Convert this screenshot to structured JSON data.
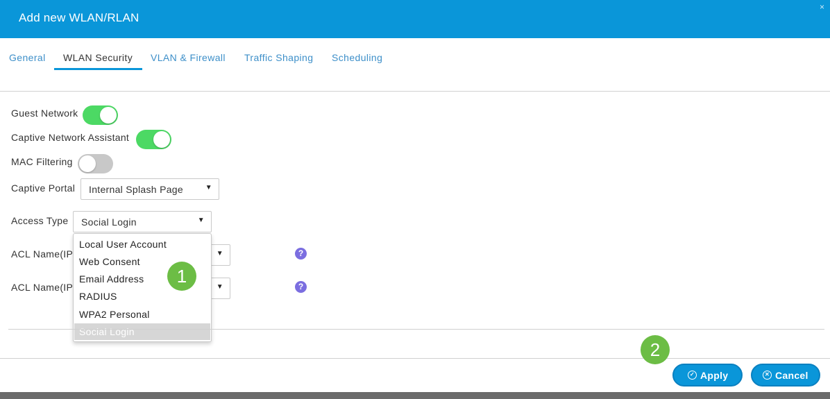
{
  "dialog": {
    "title": "Add new WLAN/RLAN",
    "close_label": "×"
  },
  "tabs": [
    {
      "label": "General"
    },
    {
      "label": "WLAN Security"
    },
    {
      "label": "VLAN & Firewall"
    },
    {
      "label": "Traffic Shaping"
    },
    {
      "label": "Scheduling"
    }
  ],
  "active_tab": "WLAN Security",
  "form": {
    "guest_network": {
      "label": "Guest Network",
      "enabled": true
    },
    "captive_network_assistant": {
      "label": "Captive Network Assistant",
      "enabled": true
    },
    "mac_filtering": {
      "label": "MAC Filtering",
      "enabled": false
    },
    "captive_portal": {
      "label": "Captive Portal",
      "value": "Internal Splash Page"
    },
    "access_type": {
      "label": "Access Type",
      "value": "Social Login"
    },
    "acl_ipv4": {
      "label": "ACL Name(IP",
      "help": "?"
    },
    "acl_ipv6": {
      "label": "ACL Name(IP",
      "help": "?"
    }
  },
  "access_type_dropdown": {
    "options": [
      "Local User Account",
      "Web Consent",
      "Email Address",
      "RADIUS",
      "WPA2 Personal",
      "Social Login"
    ],
    "selected": "Social Login"
  },
  "step_badges": [
    "1",
    "2"
  ],
  "buttons": {
    "apply": "Apply",
    "cancel": "Cancel"
  },
  "icons": {
    "apply": "check-circle-icon",
    "cancel": "x-circle-icon",
    "help": "question-circle-icon",
    "dropdown": "caret-down-icon"
  },
  "colors": {
    "header": "#0a96d9",
    "toggle_on": "#4cd964",
    "toggle_off": "#c8c8c8",
    "badge": "#6cbd45",
    "help": "#7b6ee0",
    "tab_link": "#3d8fc9"
  }
}
